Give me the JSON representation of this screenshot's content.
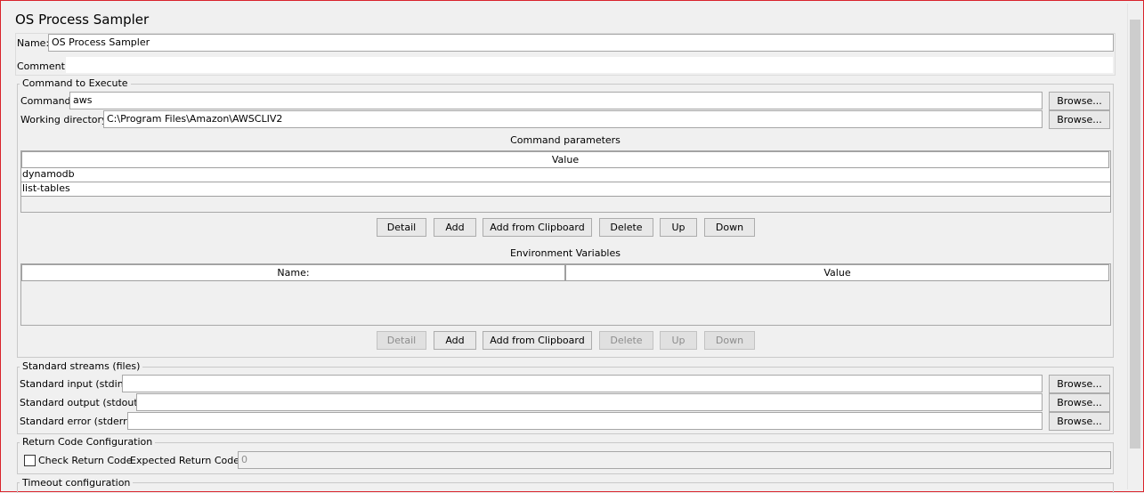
{
  "title": "OS Process Sampler",
  "name_label": "Name:",
  "name_value": "OS Process Sampler",
  "comments_label": "Comments:",
  "comments_value": "",
  "command_group": {
    "legend": "Command to Execute",
    "command_label": "Command:",
    "command_value": "aws",
    "workdir_label": "Working directory:",
    "workdir_value": "C:\\Program Files\\Amazon\\AWSCLIV2",
    "browse_label": "Browse..."
  },
  "params": {
    "title": "Command parameters",
    "column": "Value",
    "rows": [
      "dynamodb",
      "list-tables"
    ],
    "buttons": [
      "Detail",
      "Add",
      "Add from Clipboard",
      "Delete",
      "Up",
      "Down"
    ]
  },
  "env": {
    "title": "Environment Variables",
    "columns": [
      "Name:",
      "Value"
    ],
    "buttons": [
      "Detail",
      "Add",
      "Add from Clipboard",
      "Delete",
      "Up",
      "Down"
    ]
  },
  "streams": {
    "legend": "Standard streams (files)",
    "stdin_label": "Standard input (stdin):",
    "stdout_label": "Standard output (stdout):",
    "stderr_label": "Standard error (stderr):",
    "browse_label": "Browse..."
  },
  "return_code": {
    "legend": "Return Code Configuration",
    "check_label": "Check Return Code",
    "expected_label": "Expected Return Code:",
    "expected_value": "0"
  },
  "timeout": {
    "legend": "Timeout configuration"
  }
}
